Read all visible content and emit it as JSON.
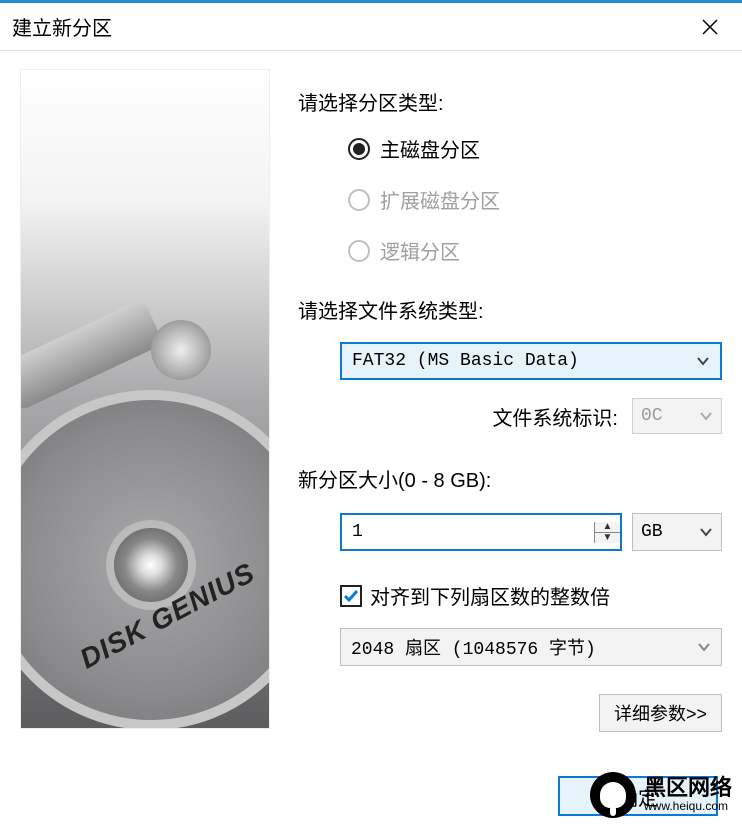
{
  "window": {
    "title": "建立新分区"
  },
  "sidebar": {
    "branding": "DISK GENIUS"
  },
  "form": {
    "partition_type_label": "请选择分区类型:",
    "radios": {
      "primary": "主磁盘分区",
      "extended": "扩展磁盘分区",
      "logical": "逻辑分区",
      "selected": "primary"
    },
    "fs_type_label": "请选择文件系统类型:",
    "fs_type_value": "FAT32 (MS Basic Data)",
    "fs_id_label": "文件系统标识:",
    "fs_id_value": "0C",
    "size_label": "新分区大小(0 - 8 GB):",
    "size_value": "1",
    "size_unit": "GB",
    "align_checkbox_label": "对齐到下列扇区数的整数倍",
    "align_checked": true,
    "align_value": "2048 扇区 (1048576 字节)",
    "advanced_button": "详细参数>>"
  },
  "footer": {
    "ok": "确定"
  },
  "watermark": {
    "text": "黑区网络",
    "url": "www.heiqu.com"
  }
}
